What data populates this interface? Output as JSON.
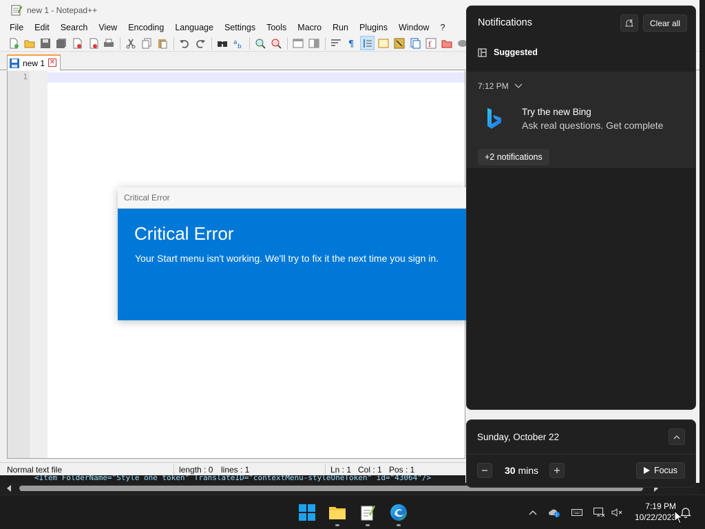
{
  "notepad": {
    "title": "new 1 - Notepad++",
    "menu": [
      "File",
      "Edit",
      "Search",
      "View",
      "Encoding",
      "Language",
      "Settings",
      "Tools",
      "Macro",
      "Run",
      "Plugins",
      "Window",
      "?"
    ],
    "tab_label": "new 1",
    "line_number": "1",
    "status": {
      "file_type": "Normal text file",
      "length": "length : 0",
      "lines": "lines : 1",
      "ln": "Ln : 1",
      "col": "Col : 1",
      "pos": "Pos : 1"
    },
    "background_code": "<Item FolderName=\"Style one token\" TranslateID=\"contextMenu-styleOneToken\" id=\"43064\"/>"
  },
  "dialog": {
    "header": "Critical Error",
    "title": "Critical Error",
    "message": "Your Start menu isn't working. We'll try to fix it the next time you sign in."
  },
  "notifications": {
    "title": "Notifications",
    "clear_all": "Clear all",
    "suggested": "Suggested",
    "time": "7:12 PM",
    "item_title": "Try the new Bing",
    "item_body": "Ask real questions. Get complete",
    "more": "+2 notifications"
  },
  "calendar": {
    "date": "Sunday, October 22",
    "focus_minutes": "30",
    "focus_unit": "mins",
    "focus_button": "Focus"
  },
  "taskbar": {
    "time": "7:19 PM",
    "date": "10/22/2023"
  },
  "colors": {
    "dialog_blue": "#0078d7",
    "tab_accent": "#f9a03c",
    "bing_gradient": [
      "#2ec4f0",
      "#1f6fe5"
    ]
  }
}
